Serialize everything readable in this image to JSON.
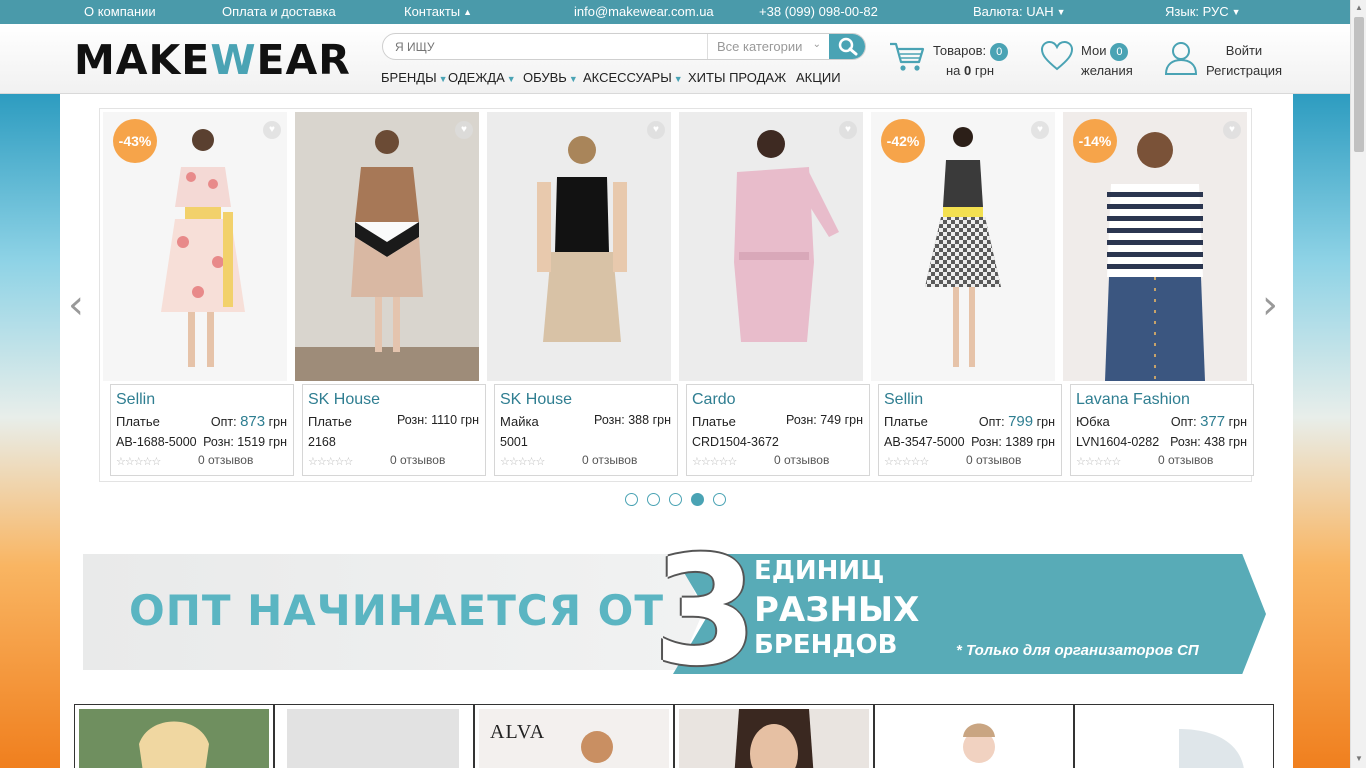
{
  "topbar": {
    "about": "О компании",
    "payment": "Оплата и доставка",
    "contacts": "Контакты",
    "email": "info@makewear.com.ua",
    "phone": "+38 (099) 098-00-82",
    "currency": "Валюта: UAH",
    "language": "Язык: РУС"
  },
  "header": {
    "logo_part1": "MAKE",
    "logo_part2": "W",
    "logo_part3": "EAR",
    "search_placeholder": "Я ИЩУ",
    "category_select": "Все категории",
    "nav": [
      "БРЕНДЫ",
      "ОДЕЖДА",
      "ОБУВЬ",
      "АКСЕССУАРЫ",
      "ХИТЫ ПРОДАЖ",
      "АКЦИИ"
    ],
    "cart_label": "Товаров:",
    "cart_count": "0",
    "cart_sum_prefix": "на",
    "cart_sum": "0",
    "cart_currency": "грн",
    "wish_label1": "Мои",
    "wish_count": "0",
    "wish_label2": "желания",
    "login": "Войти",
    "register": "Регистрация"
  },
  "products": [
    {
      "discount": "-43%",
      "brand": "Sellin",
      "type": "Платье",
      "price1_label": "Опт:",
      "price1": "873",
      "price1_cur": "грн",
      "sku": "AB-1688-5000",
      "price2": "Розн: 1519 грн",
      "reviews": "0 отзывов"
    },
    {
      "discount": "",
      "brand": "SK House",
      "type": "Платье",
      "price1_label": "Розн:",
      "price1": "1110",
      "price1_cur": "грн",
      "sku": "2168",
      "price2": "",
      "reviews": "0 отзывов"
    },
    {
      "discount": "",
      "brand": "SK House",
      "type": "Майка",
      "price1_label": "Розн:",
      "price1": "388",
      "price1_cur": "грн",
      "sku": "5001",
      "price2": "",
      "reviews": "0 отзывов"
    },
    {
      "discount": "",
      "brand": "Cardo",
      "type": "Платье",
      "price1_label": "Розн:",
      "price1": "749",
      "price1_cur": "грн",
      "sku": "CRD1504-3672",
      "price2": "",
      "reviews": "0 отзывов"
    },
    {
      "discount": "-42%",
      "brand": "Sellin",
      "type": "Платье",
      "price1_label": "Опт:",
      "price1": "799",
      "price1_cur": "грн",
      "sku": "AB-3547-5000",
      "price2": "Розн: 1389 грн",
      "reviews": "0 отзывов"
    },
    {
      "discount": "-14%",
      "brand": "Lavana Fashion",
      "type": "Юбка",
      "price1_label": "Опт:",
      "price1": "377",
      "price1_cur": "грн",
      "sku": "LVN1604-0282",
      "price2": "Розн: 438 грн",
      "reviews": "0 отзывов"
    }
  ],
  "carousel": {
    "page_count": 5,
    "active_page": 4,
    "prev": "‹",
    "next": "›"
  },
  "banner": {
    "left_text": "ОПТ НАЧИНАЕТСЯ ОТ",
    "number": "3",
    "line1": "ЕДИНИЦ",
    "line2": "РАЗНЫХ",
    "line3": "БРЕНДОВ",
    "note": "* Только для организаторов СП"
  },
  "brand_tiles": [
    "",
    "",
    "ALVA",
    "",
    "",
    ""
  ],
  "colors": {
    "accent": "#4aa3b4",
    "discount": "#f6a44a",
    "topbar": "#4a9aaa"
  }
}
